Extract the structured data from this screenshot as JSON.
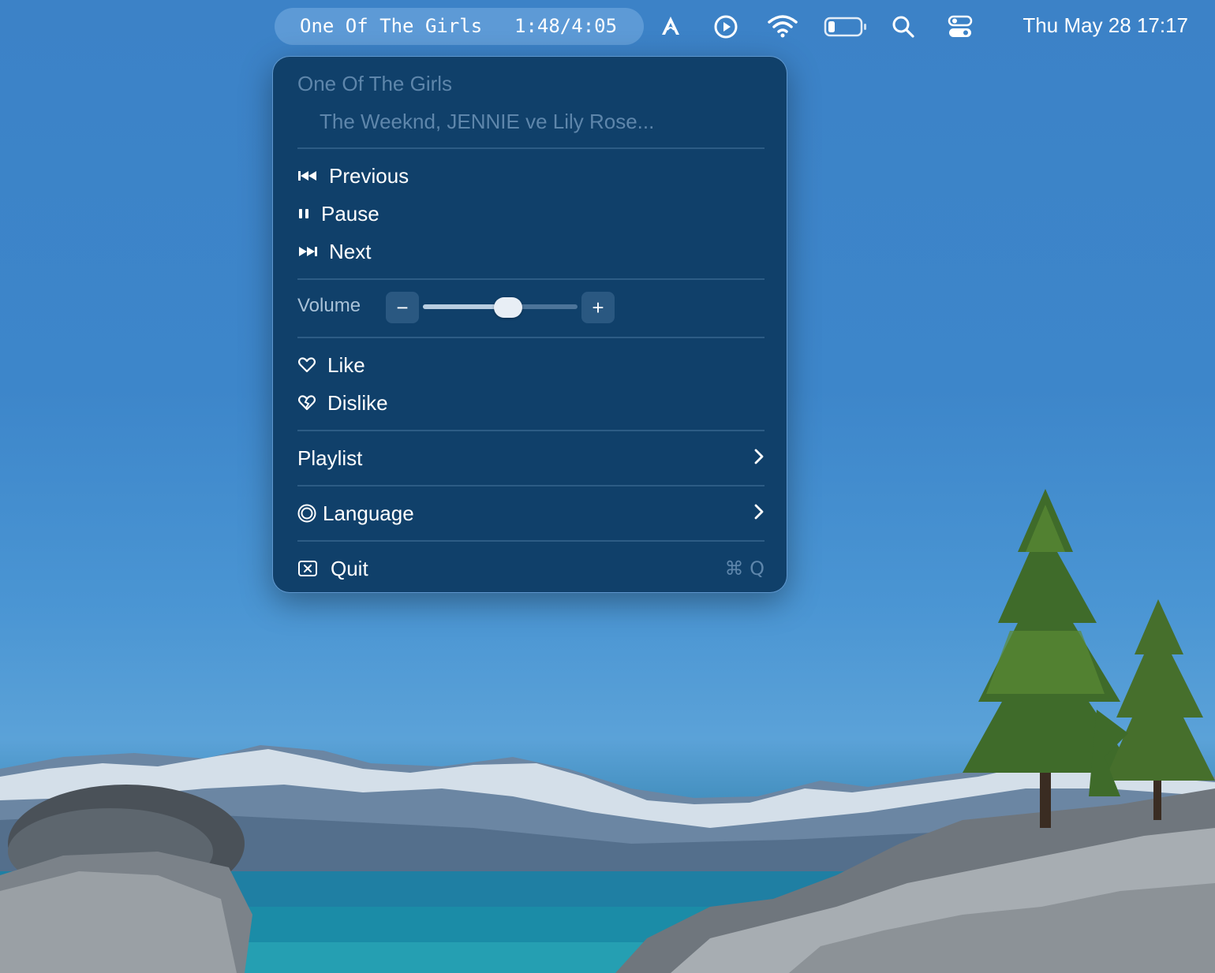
{
  "menubar": {
    "now_playing_title": "One Of The Girls",
    "now_playing_time": "1:48/4:05",
    "icons": [
      "app-logo-icon",
      "play-circle-icon",
      "wifi-icon",
      "battery-icon",
      "search-icon",
      "control-center-icon"
    ],
    "clock": "Thu May 28  17:17"
  },
  "menu": {
    "track_title": "One Of The Girls",
    "track_artist": "The Weeknd, JENNIE ve Lily Rose...",
    "playback": {
      "previous": "Previous",
      "pause": "Pause",
      "next": "Next"
    },
    "volume": {
      "label": "Volume",
      "minus": "−",
      "plus": "+",
      "level": 0.55
    },
    "like": "Like",
    "dislike": "Dislike",
    "playlist": "Playlist",
    "language": "Language",
    "quit": "Quit",
    "quit_shortcut": "⌘ Q"
  },
  "colors": {
    "menu_bg": "#10406a",
    "menu_border": "#78b4f0",
    "dim_text": "#5e86ab"
  }
}
